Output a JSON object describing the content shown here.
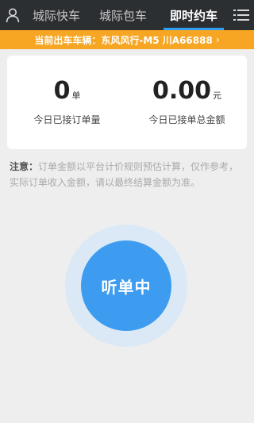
{
  "header": {
    "user_icon": "user-icon",
    "menu_icon": "list-menu-icon",
    "tabs": [
      {
        "label": "城际快车",
        "active": false
      },
      {
        "label": "城际包车",
        "active": false
      },
      {
        "label": "即时约车",
        "active": true
      }
    ]
  },
  "vehicle": {
    "text": "当前出车车辆：东风风行-M5 川A66888",
    "chevron": "›"
  },
  "stats": {
    "orders": {
      "value": "0",
      "unit": "单",
      "label": "今日已接订单量"
    },
    "amount": {
      "value": "0.00",
      "unit": "元",
      "label": "今日已接单总金额"
    }
  },
  "notice": {
    "label": "注意：",
    "text": "订单金额以平台计价规则预估计算，仅作参考，实际订单收入金额，请以最终结算金额为准。"
  },
  "listen_button": {
    "label": "听单中"
  },
  "colors": {
    "topbar": "#2c2f32",
    "tab_underline": "#2f9ff5",
    "vehicle_bar": "#f6a623",
    "button": "#3d9cf0",
    "button_ring": "#dbe9f6",
    "background": "#eeeeee"
  }
}
